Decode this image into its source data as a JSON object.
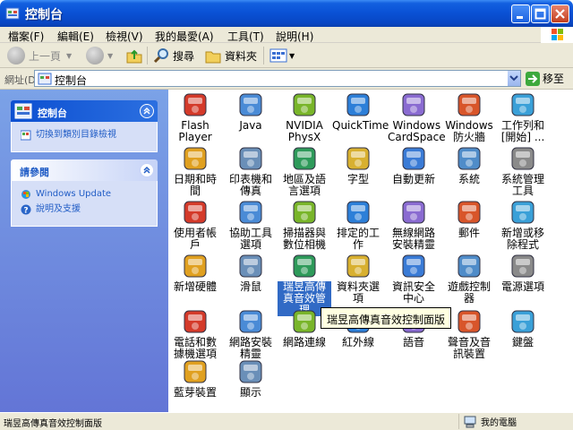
{
  "window": {
    "title": "控制台"
  },
  "menu": [
    "檔案(F)",
    "編輯(E)",
    "檢視(V)",
    "我的最愛(A)",
    "工具(T)",
    "說明(H)"
  ],
  "toolbar": {
    "back": "上一頁",
    "search": "搜尋",
    "folders": "資料夾"
  },
  "address": {
    "label": "網址(D)",
    "value": "控制台",
    "go": "移至"
  },
  "left_pane": {
    "panel1": {
      "title": "控制台",
      "link": "切換到類別目錄檢視"
    },
    "panel2": {
      "title": "請參閱",
      "links": [
        "Windows Update",
        "說明及支援"
      ]
    }
  },
  "items": [
    {
      "label": "Flash Player",
      "icon": "flash-icon"
    },
    {
      "label": "Java",
      "icon": "java-icon"
    },
    {
      "label": "NVIDIA PhysX",
      "icon": "nvidia-icon"
    },
    {
      "label": "QuickTime",
      "icon": "quicktime-icon"
    },
    {
      "label": "Windows CardSpace",
      "icon": "cardspace-icon"
    },
    {
      "label": "Windows 防火牆",
      "icon": "firewall-icon"
    },
    {
      "label": "工作列和 [開始] ...",
      "icon": "taskbar-icon"
    },
    {
      "label": "日期和時間",
      "icon": "clock-icon"
    },
    {
      "label": "印表機和傳真",
      "icon": "printer-icon"
    },
    {
      "label": "地區及語言選項",
      "icon": "globe-icon"
    },
    {
      "label": "字型",
      "icon": "fonts-folder-icon"
    },
    {
      "label": "自動更新",
      "icon": "windows-update-icon"
    },
    {
      "label": "系統",
      "icon": "system-icon"
    },
    {
      "label": "系統管理工具",
      "icon": "admin-tools-icon"
    },
    {
      "label": "使用者帳戶",
      "icon": "users-icon"
    },
    {
      "label": "協助工具選項",
      "icon": "accessibility-icon"
    },
    {
      "label": "掃描器與數位相機",
      "icon": "scanner-icon"
    },
    {
      "label": "排定的工作",
      "icon": "scheduled-tasks-icon"
    },
    {
      "label": "無線網路安裝精靈",
      "icon": "wireless-wizard-icon"
    },
    {
      "label": "郵件",
      "icon": "mail-icon"
    },
    {
      "label": "新增或移除程式",
      "icon": "add-remove-icon"
    },
    {
      "label": "新增硬體",
      "icon": "add-hardware-icon"
    },
    {
      "label": "滑鼠",
      "icon": "mouse-icon"
    },
    {
      "label": "瑞昱高傳真音效管理",
      "icon": "realtek-audio-icon"
    },
    {
      "label": "資料夾選項",
      "icon": "folder-options-icon"
    },
    {
      "label": "資訊安全中心",
      "icon": "security-center-icon"
    },
    {
      "label": "遊戲控制器",
      "icon": "game-controller-icon"
    },
    {
      "label": "電源選項",
      "icon": "power-icon"
    },
    {
      "label": "電話和數據機選項",
      "icon": "phone-modem-icon"
    },
    {
      "label": "網路安裝精靈",
      "icon": "network-wizard-icon"
    },
    {
      "label": "網路連線",
      "icon": "network-connections-icon"
    },
    {
      "label": "紅外線",
      "icon": "infrared-icon"
    },
    {
      "label": "語音",
      "icon": "speech-icon"
    },
    {
      "label": "聲音及音訊裝置",
      "icon": "sound-icon"
    },
    {
      "label": "鍵盤",
      "icon": "keyboard-icon"
    },
    {
      "label": "藍芽裝置",
      "icon": "bluetooth-icon"
    },
    {
      "label": "顯示",
      "icon": "display-icon"
    }
  ],
  "tooltip": "瑞昱高傳真音效控制面版",
  "status": {
    "left": "瑞昱高傳真音效控制面版",
    "right": "我的電腦"
  },
  "colors": {
    "title_bar": "#0a52d6",
    "left_pane": "#7ba2e7",
    "selection": "#316ac5",
    "tooltip_bg": "#ffffe1"
  }
}
